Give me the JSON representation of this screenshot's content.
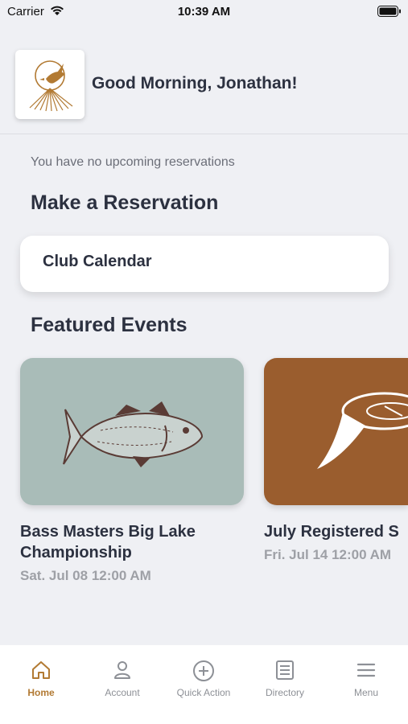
{
  "status": {
    "carrier": "Carrier",
    "time": "10:39 AM"
  },
  "header": {
    "greeting": "Good Morning, Jonathan!"
  },
  "reservations": {
    "empty_text": "You have no upcoming reservations"
  },
  "make_reservation": {
    "title": "Make a Reservation",
    "calendar_label": "Club Calendar"
  },
  "featured": {
    "title": "Featured Events",
    "events": [
      {
        "title": "Bass Masters Big Lake Championship",
        "date": "Sat. Jul 08 12:00 AM",
        "image_icon": "fish-illustration",
        "bg_color": "#a9bcb8"
      },
      {
        "title": "July Registered S",
        "date": "Fri. Jul 14 12:00 AM",
        "image_icon": "clay-target-illustration",
        "bg_color": "#9a5d2e"
      }
    ]
  },
  "tabs": [
    {
      "label": "Home",
      "icon": "home-icon",
      "active": true
    },
    {
      "label": "Account",
      "icon": "account-icon",
      "active": false
    },
    {
      "label": "Quick Action",
      "icon": "plus-circle-icon",
      "active": false
    },
    {
      "label": "Directory",
      "icon": "directory-icon",
      "active": false
    },
    {
      "label": "Menu",
      "icon": "menu-icon",
      "active": false
    }
  ],
  "colors": {
    "accent": "#b27a33",
    "background": "#eff0f4",
    "text": "#2c3140"
  }
}
